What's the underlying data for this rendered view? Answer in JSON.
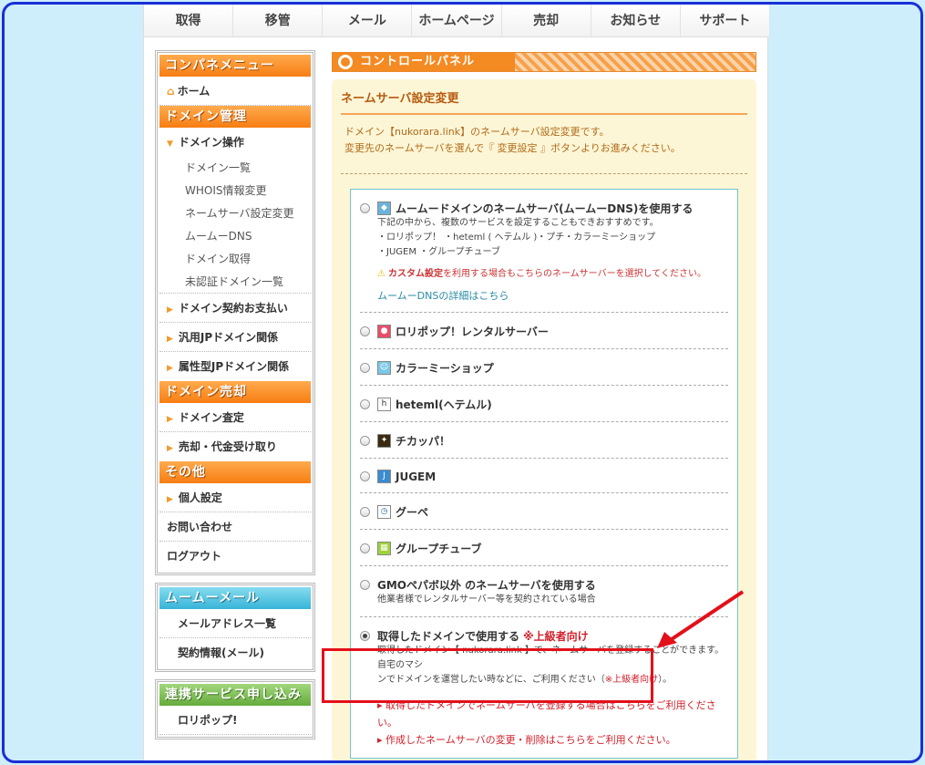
{
  "topnav": [
    "取得",
    "移管",
    "メール",
    "ホームページ",
    "売却",
    "お知らせ",
    "サポート"
  ],
  "sidebar": {
    "cp_menu_title": "コンパネメニュー",
    "home": "ホーム",
    "domain_mgmt_title": "ドメイン管理",
    "domain_ops": "ドメイン操作",
    "domain_ops_items": [
      "ドメイン一覧",
      "WHOIS情報変更",
      "ネームサーバ設定変更",
      "ムームーDNS",
      "ドメイン取得",
      "未認証ドメイン一覧"
    ],
    "domain_contract": "ドメイン契約お支払い",
    "jp_general": "汎用JPドメイン関係",
    "jp_attr": "属性型JPドメイン関係",
    "domain_sale_title": "ドメイン売却",
    "domain_appraisal": "ドメイン査定",
    "sale_payment": "売却・代金受け取り",
    "other_title": "その他",
    "personal": "個人設定",
    "contact": "お問い合わせ",
    "logout": "ログアウト",
    "mail_title": "ムームーメール",
    "mail_address_list": "メールアドレス一覧",
    "mail_contract": "契約情報(メール)",
    "linked_title": "連携サービス申し込み",
    "lolipop": "ロリポップ!"
  },
  "main": {
    "cp_title": "コントロールパネル",
    "section_title": "ネームサーバ設定変更",
    "desc1": "ドメイン【nukorara.link】のネームサーバ設定変更です。",
    "desc2": "変更先のネームサーバを選んで『 変更設定 』ボタンよりお進みください。",
    "options": {
      "muumuu": {
        "label": "ムームードメインのネームサーバ(ムームーDNS)を使用する",
        "sub1": "下記の中から、複数のサービスを設定することもできおすすめです。",
        "sub2": "・ロリポップ！ ・heteml ( ヘテムル )・プチ・カラーミーショップ",
        "sub3": "・JUGEM ・グループチューブ",
        "warn_strong": "カスタム設定",
        "warn_rest": "を利用する場合もこちらのネームサーバーを選択してください。",
        "link": "ムームーDNSの詳細はこちら"
      },
      "lolipop": "ロリポップ！レンタルサーバー",
      "colorme": "カラーミーショップ",
      "heteml": "heteml(ヘテムル)",
      "chicappa": "チカッパ！",
      "jugem": "JUGEM",
      "goope": "グーペ",
      "grouptube": "グループチューブ",
      "gmo": {
        "label": "GMOペパボ以外 のネームサーバを使用する",
        "sub": "他業者様でレンタルサーバー等を契約されている場合"
      },
      "own": {
        "label": "取得したドメインで使用する",
        "note": "※上級者向け",
        "sub1": "取得したドメイン【 nukorara.link 】で、ネームサーバを登録することができます。自宅のマシ",
        "sub2": "ンでドメインを運営したい時などに、ご利用ください（",
        "sub2_note": "※上級者向け",
        "sub2_end": "）。",
        "link1": "取得したドメインでネームサーバを登録する場合はこちらをご利用ください。",
        "link2": "作成したネームサーバの変更・削除はこちらをご利用ください。"
      }
    }
  },
  "colors": {
    "accent": "#f48a22",
    "highlight": "#e3101a",
    "border": "#1a2fd6"
  }
}
